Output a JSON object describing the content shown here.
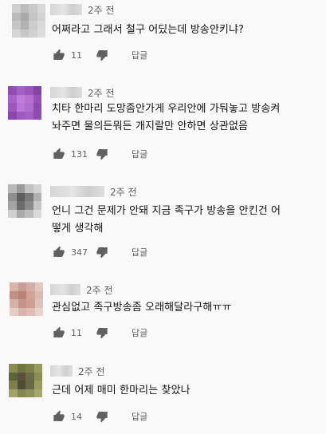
{
  "reply_label": "답글",
  "comments": [
    {
      "time": "2주 전",
      "text": "어쩌라고 그래서 철구 어딨는데 방송안키냐?",
      "likes": "11",
      "avatar_colors": [
        "#cfcfcf",
        "#bdbdbd",
        "#c9c9c9",
        "#d8d8d8",
        "#b9b9b9",
        "#a9a9a9",
        "#c4c4c4",
        "#d2d2d2",
        "#c6c6c6",
        "#b2b2b2",
        "#cccccc",
        "#dadada",
        "#d5d5d5",
        "#c8c8c8",
        "#d0d0d0",
        "#dcdcdc"
      ]
    },
    {
      "time": "2주 전",
      "text": "치타 한마리 도망좀안가게 우리안에 가둬놓고 방송켜\n놔주면 물의든뭐든 개지랄만 안하면 상관없음",
      "likes": "131",
      "avatar_colors": [
        "#8e4fb0",
        "#a55fc4",
        "#9a55bb",
        "#8444a4",
        "#a662c7",
        "#c07ad9",
        "#b56fd0",
        "#9650b6",
        "#9d58bd",
        "#bb76d6",
        "#b06acc",
        "#8d4bae",
        "#8a48aa",
        "#9e5abe",
        "#a35fc2",
        "#904db1"
      ]
    },
    {
      "time": "2주 전",
      "text": "언니 그건 문제가 안돼 지금 족구가 방송을 안킨건 어\n떻게 생각해",
      "likes": "347",
      "avatar_colors": [
        "#b9b9b9",
        "#9a9a9a",
        "#c2c2c2",
        "#d2d2d2",
        "#8f8f8f",
        "#5e5e5e",
        "#7a7a7a",
        "#b0b0b0",
        "#a4a4a4",
        "#6b6b6b",
        "#8a8a8a",
        "#c6c6c6",
        "#cfcfcf",
        "#a8a8a8",
        "#bcbcbc",
        "#dadada"
      ]
    },
    {
      "time": "2주 전",
      "text": "관심없고 족구방송좀 오래해달라구해ㅠㅠ",
      "likes": "11",
      "avatar_colors": [
        "#d9b4ad",
        "#c99c94",
        "#d4ada6",
        "#e3c6bf",
        "#c28f85",
        "#b98379",
        "#cfa39a",
        "#dcbab2",
        "#d6b2aa",
        "#c49389",
        "#cda096",
        "#e0c1ba",
        "#e6cdc7",
        "#d7b4ac",
        "#dfbeb6",
        "#ead3cd"
      ]
    },
    {
      "time": "2주 전",
      "text": "근데 어제 매미 한마리는 찾았나",
      "likes": "14",
      "avatar_colors": [
        "#8a8c52",
        "#6f7440",
        "#7c7f48",
        "#979a5f",
        "#5f6436",
        "#5a4f3a",
        "#6d6a44",
        "#8c8e56",
        "#7f8049",
        "#4f4c33",
        "#6b6742",
        "#9a9b63",
        "#a2a36b",
        "#858653",
        "#8f915a",
        "#a5a771"
      ]
    }
  ]
}
